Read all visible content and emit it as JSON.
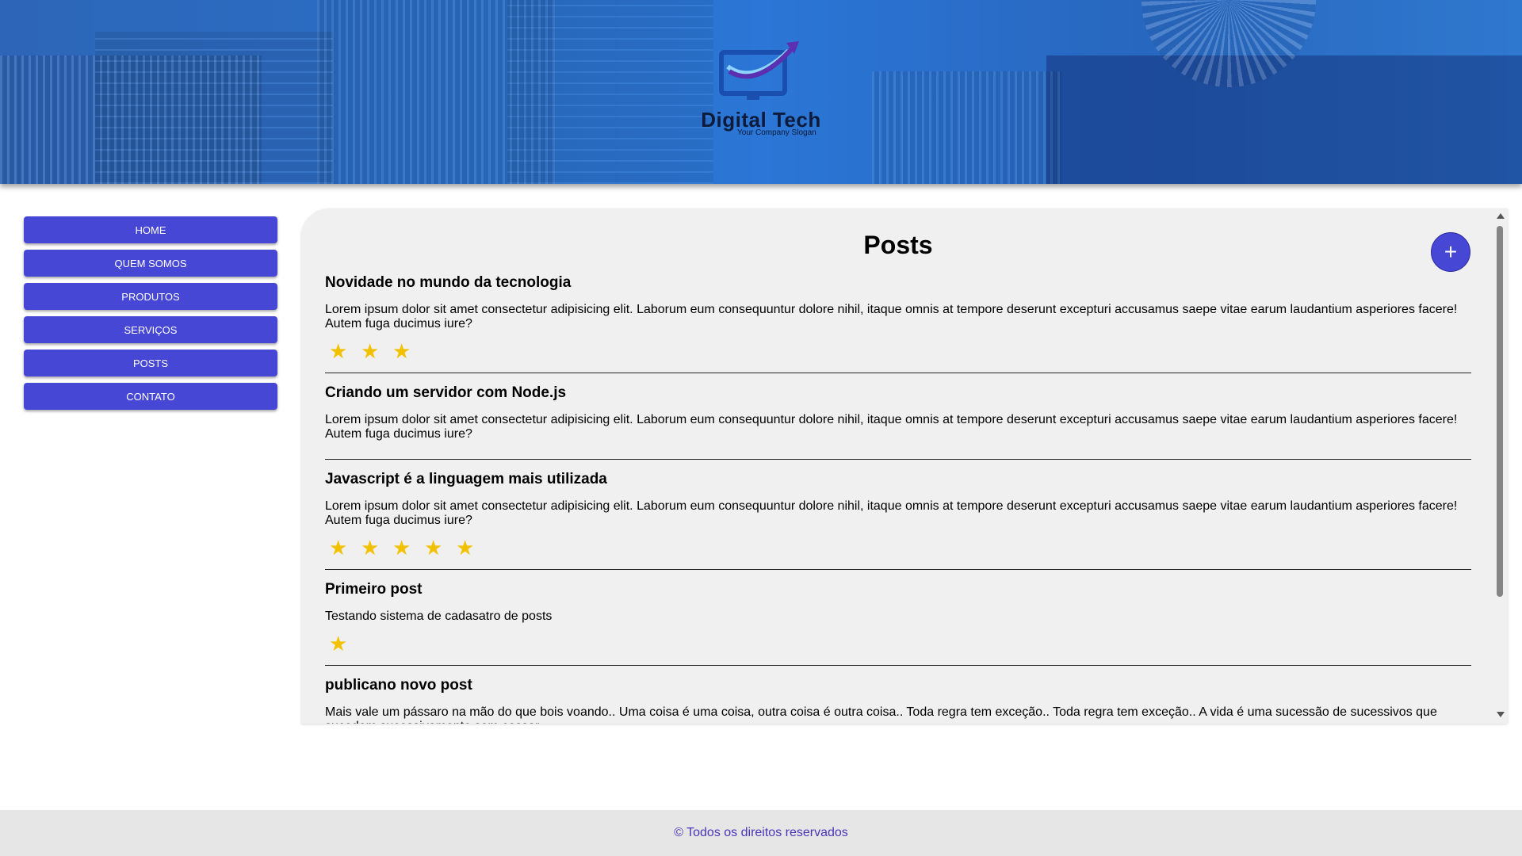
{
  "header": {
    "logo_title": "Digital Tech",
    "logo_slogan": "Your Company Slogan"
  },
  "sidebar": {
    "items": [
      {
        "label": "HOME"
      },
      {
        "label": "QUEM SOMOS"
      },
      {
        "label": "PRODUTOS"
      },
      {
        "label": "SERVIÇOS"
      },
      {
        "label": "POSTS"
      },
      {
        "label": "CONTATO"
      }
    ]
  },
  "main": {
    "title": "Posts",
    "add_label": "+",
    "posts": [
      {
        "title": "Novidade no mundo da tecnologia",
        "body": "Lorem ipsum dolor sit amet consectetur adipisicing elit. Laborum eum consequuntur dolore nihil, itaque omnis at tempore deserunt excepturi accusamus saepe vitae earum laudantium asperiores facere! Autem fuga ducimus iure?",
        "rating": 3
      },
      {
        "title": "Criando um servidor com Node.js",
        "body": "Lorem ipsum dolor sit amet consectetur adipisicing elit. Laborum eum consequuntur dolore nihil, itaque omnis at tempore deserunt excepturi accusamus saepe vitae earum laudantium asperiores facere! Autem fuga ducimus iure?",
        "rating": 0
      },
      {
        "title": "Javascript é a linguagem mais utilizada",
        "body": "Lorem ipsum dolor sit amet consectetur adipisicing elit. Laborum eum consequuntur dolore nihil, itaque omnis at tempore deserunt excepturi accusamus saepe vitae earum laudantium asperiores facere! Autem fuga ducimus iure?",
        "rating": 5
      },
      {
        "title": "Primeiro post",
        "body": "Testando sistema de cadasatro de posts",
        "rating": 1
      },
      {
        "title": "publicano novo post",
        "body": "Mais vale um pássaro na mão do que bois voando.. Uma coisa é uma coisa, outra coisa é outra coisa.. Toda regra tem exceção.. Toda regra tem exceção.. A vida é uma sucessão de sucessivos que sucedem sucessivamente sem cessar",
        "rating": 0
      }
    ]
  },
  "colors": {
    "accent": "#4747d6",
    "star": "#f2c200",
    "footer_text": "#4a35b8"
  },
  "icons": {
    "star": "star-icon",
    "add": "plus-icon"
  },
  "footer": {
    "text": "© Todos os direitos reservados"
  }
}
